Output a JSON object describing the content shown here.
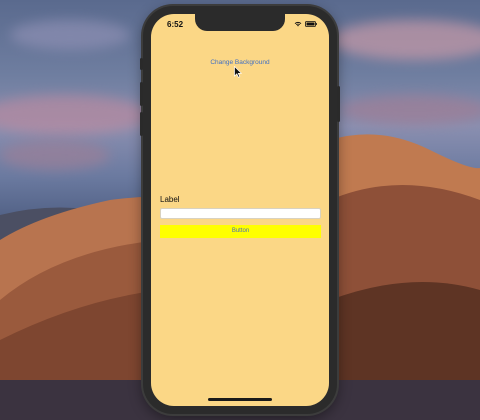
{
  "status_bar": {
    "time": "6:52",
    "icons": [
      "wifi-icon",
      "battery-icon"
    ]
  },
  "app": {
    "change_background_label": "Change Background",
    "label_text": "Label",
    "text_field_value": "",
    "button_label": "Button"
  },
  "colors": {
    "screen_background": "#fbd786",
    "button_background": "#ffff00",
    "link_color": "#3f6fc4"
  }
}
